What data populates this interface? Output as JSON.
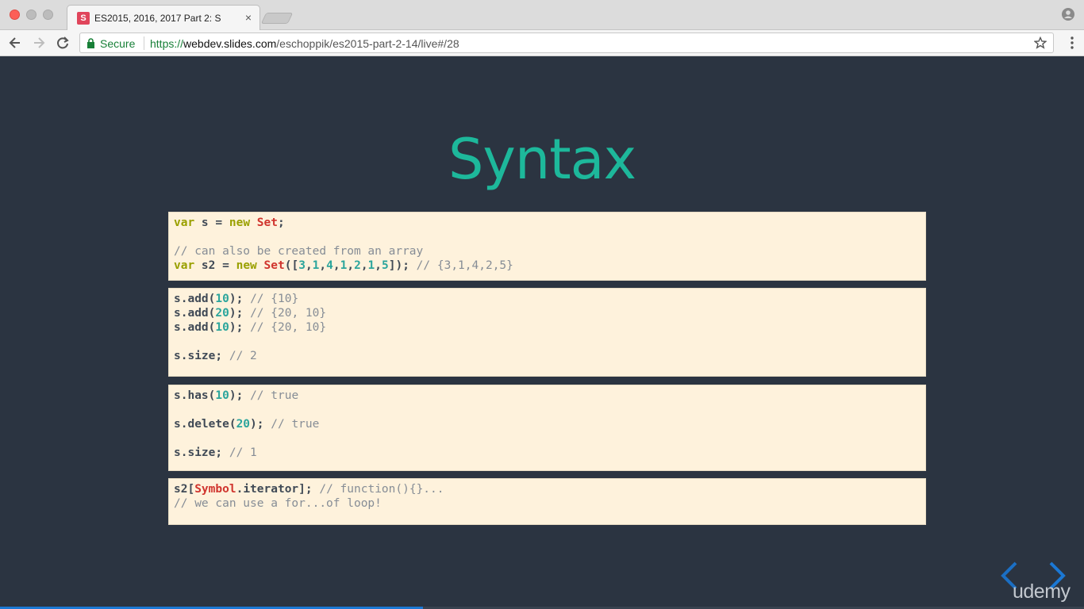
{
  "browser": {
    "tab_title": "ES2015, 2016, 2017 Part 2: S",
    "favicon_letter": "S",
    "tab_close": "×",
    "secure_label": "Secure",
    "url_scheme": "https://",
    "url_host": "webdev.slides.com",
    "url_path": "/eschoppik/es2015-part-2-14/live#/28"
  },
  "slide": {
    "title": "Syntax",
    "accent_color": "#1db89b",
    "code_blocks": [
      {
        "lines": [
          [
            {
              "t": "var",
              "c": "kw"
            },
            {
              "t": " s = ",
              "c": "id"
            },
            {
              "t": "new",
              "c": "kw"
            },
            {
              "t": " ",
              "c": "id"
            },
            {
              "t": "Set",
              "c": "cls"
            },
            {
              "t": ";",
              "c": "id"
            }
          ],
          [],
          [
            {
              "t": "// can also be created from an array",
              "c": "cm"
            }
          ],
          [
            {
              "t": "var",
              "c": "kw"
            },
            {
              "t": " s2 = ",
              "c": "id"
            },
            {
              "t": "new",
              "c": "kw"
            },
            {
              "t": " ",
              "c": "id"
            },
            {
              "t": "Set",
              "c": "cls"
            },
            {
              "t": "([",
              "c": "id"
            },
            {
              "t": "3",
              "c": "num"
            },
            {
              "t": ",",
              "c": "id"
            },
            {
              "t": "1",
              "c": "num"
            },
            {
              "t": ",",
              "c": "id"
            },
            {
              "t": "4",
              "c": "num"
            },
            {
              "t": ",",
              "c": "id"
            },
            {
              "t": "1",
              "c": "num"
            },
            {
              "t": ",",
              "c": "id"
            },
            {
              "t": "2",
              "c": "num"
            },
            {
              "t": ",",
              "c": "id"
            },
            {
              "t": "1",
              "c": "num"
            },
            {
              "t": ",",
              "c": "id"
            },
            {
              "t": "5",
              "c": "num"
            },
            {
              "t": "]); ",
              "c": "id"
            },
            {
              "t": "// {3,1,4,2,5}",
              "c": "cm"
            }
          ]
        ]
      },
      {
        "lines": [
          [
            {
              "t": "s.add(",
              "c": "id"
            },
            {
              "t": "10",
              "c": "num"
            },
            {
              "t": "); ",
              "c": "id"
            },
            {
              "t": "// {10}",
              "c": "cm"
            }
          ],
          [
            {
              "t": "s.add(",
              "c": "id"
            },
            {
              "t": "20",
              "c": "num"
            },
            {
              "t": "); ",
              "c": "id"
            },
            {
              "t": "// {20, 10}",
              "c": "cm"
            }
          ],
          [
            {
              "t": "s.add(",
              "c": "id"
            },
            {
              "t": "10",
              "c": "num"
            },
            {
              "t": "); ",
              "c": "id"
            },
            {
              "t": "// {20, 10}",
              "c": "cm"
            }
          ],
          [],
          [
            {
              "t": "s.size; ",
              "c": "id"
            },
            {
              "t": "// 2",
              "c": "cm"
            }
          ]
        ]
      },
      {
        "lines": [
          [
            {
              "t": "s.has(",
              "c": "id"
            },
            {
              "t": "10",
              "c": "num"
            },
            {
              "t": "); ",
              "c": "id"
            },
            {
              "t": "// true",
              "c": "cm"
            }
          ],
          [],
          [
            {
              "t": "s.delete(",
              "c": "id"
            },
            {
              "t": "20",
              "c": "num"
            },
            {
              "t": "); ",
              "c": "id"
            },
            {
              "t": "// true",
              "c": "cm"
            }
          ],
          [],
          [
            {
              "t": "s.size; ",
              "c": "id"
            },
            {
              "t": "// 1",
              "c": "cm"
            }
          ]
        ]
      },
      {
        "lines": [
          [
            {
              "t": "s2[",
              "c": "id"
            },
            {
              "t": "Symbol",
              "c": "cls"
            },
            {
              "t": ".iterator]; ",
              "c": "id"
            },
            {
              "t": "// function(){}...",
              "c": "cm"
            }
          ],
          [
            {
              "t": "// we can use a for...of loop!",
              "c": "cm"
            }
          ]
        ]
      }
    ]
  },
  "footer": {
    "logo_text": "udemy",
    "progress": 0.39,
    "progress_color": "#1b78d4"
  }
}
